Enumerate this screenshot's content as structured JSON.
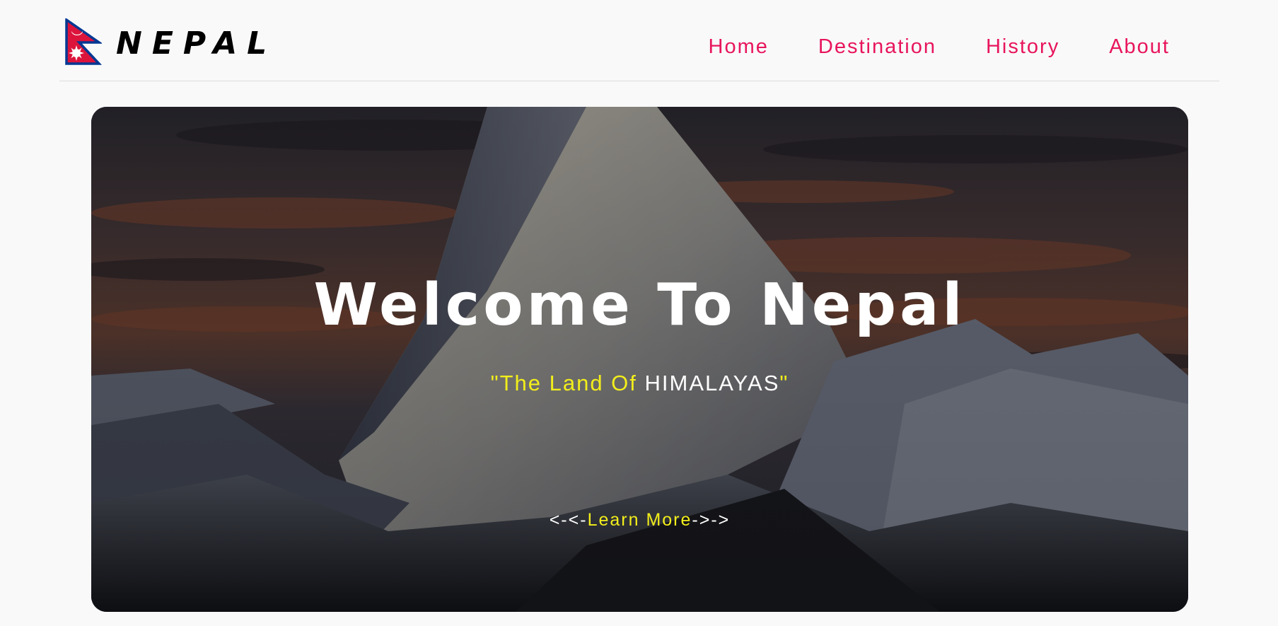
{
  "header": {
    "brand": "NEPAL",
    "nav": [
      "Home",
      "Destination",
      "History",
      "About"
    ]
  },
  "hero": {
    "title": "Welcome To Nepal",
    "subtitle_open_quote": "\"",
    "subtitle_yellow": "The Land Of",
    "subtitle_white": "HIMALAYAS",
    "subtitle_close_quote": "\"",
    "learn_prefix": "<-<-",
    "learn_label": "Learn More",
    "learn_suffix": "->->"
  },
  "colors": {
    "nav": "#e8155c",
    "accent_yellow": "#f2ee1b",
    "background": "#f9f9fa"
  },
  "icons": {
    "logo": "nepal-flag-icon"
  }
}
